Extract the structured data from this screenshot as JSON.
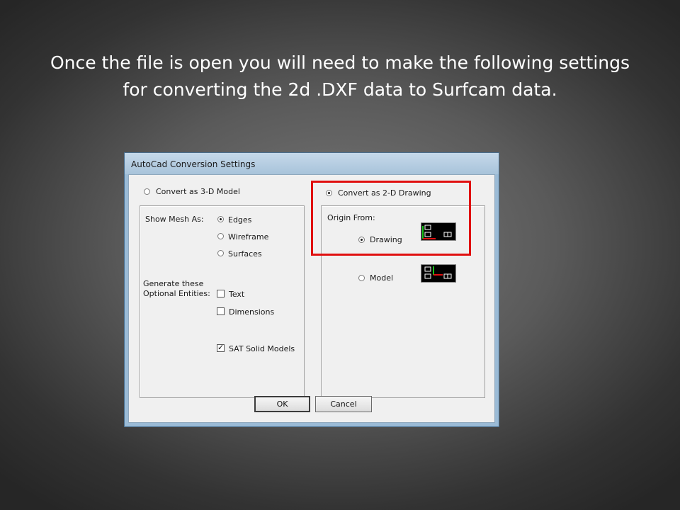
{
  "slide": {
    "title_line1": "Once the file is open you will need to make the following settings",
    "title_line2": "for converting the 2d .DXF data to Surfcam data."
  },
  "dialog": {
    "title": "AutoCad Conversion Settings",
    "model_3d": {
      "radio_label": "Convert as 3-D Model",
      "selected": false,
      "show_mesh_label": "Show Mesh As:",
      "mesh_options": [
        {
          "label": "Edges",
          "selected": true
        },
        {
          "label": "Wireframe",
          "selected": false
        },
        {
          "label": "Surfaces",
          "selected": false
        }
      ],
      "optional_label_line1": "Generate these",
      "optional_label_line2": "Optional Entities:",
      "entities": [
        {
          "label": "Text",
          "checked": false
        },
        {
          "label": "Dimensions",
          "checked": false
        },
        {
          "label": "SAT Solid Models",
          "checked": true
        }
      ]
    },
    "drawing_2d": {
      "radio_label": "Convert as 2-D Drawing",
      "selected": true,
      "origin_label": "Origin From:",
      "origin_options": [
        {
          "label": "Drawing",
          "selected": true,
          "icon": "origin-drawing-preview-icon"
        },
        {
          "label": "Model",
          "selected": false,
          "icon": "origin-model-preview-icon"
        }
      ]
    },
    "buttons": {
      "ok": "OK",
      "cancel": "Cancel"
    }
  },
  "colors": {
    "highlight": "#e01010",
    "axis_green": "#16c316",
    "axis_red": "#e01010"
  }
}
